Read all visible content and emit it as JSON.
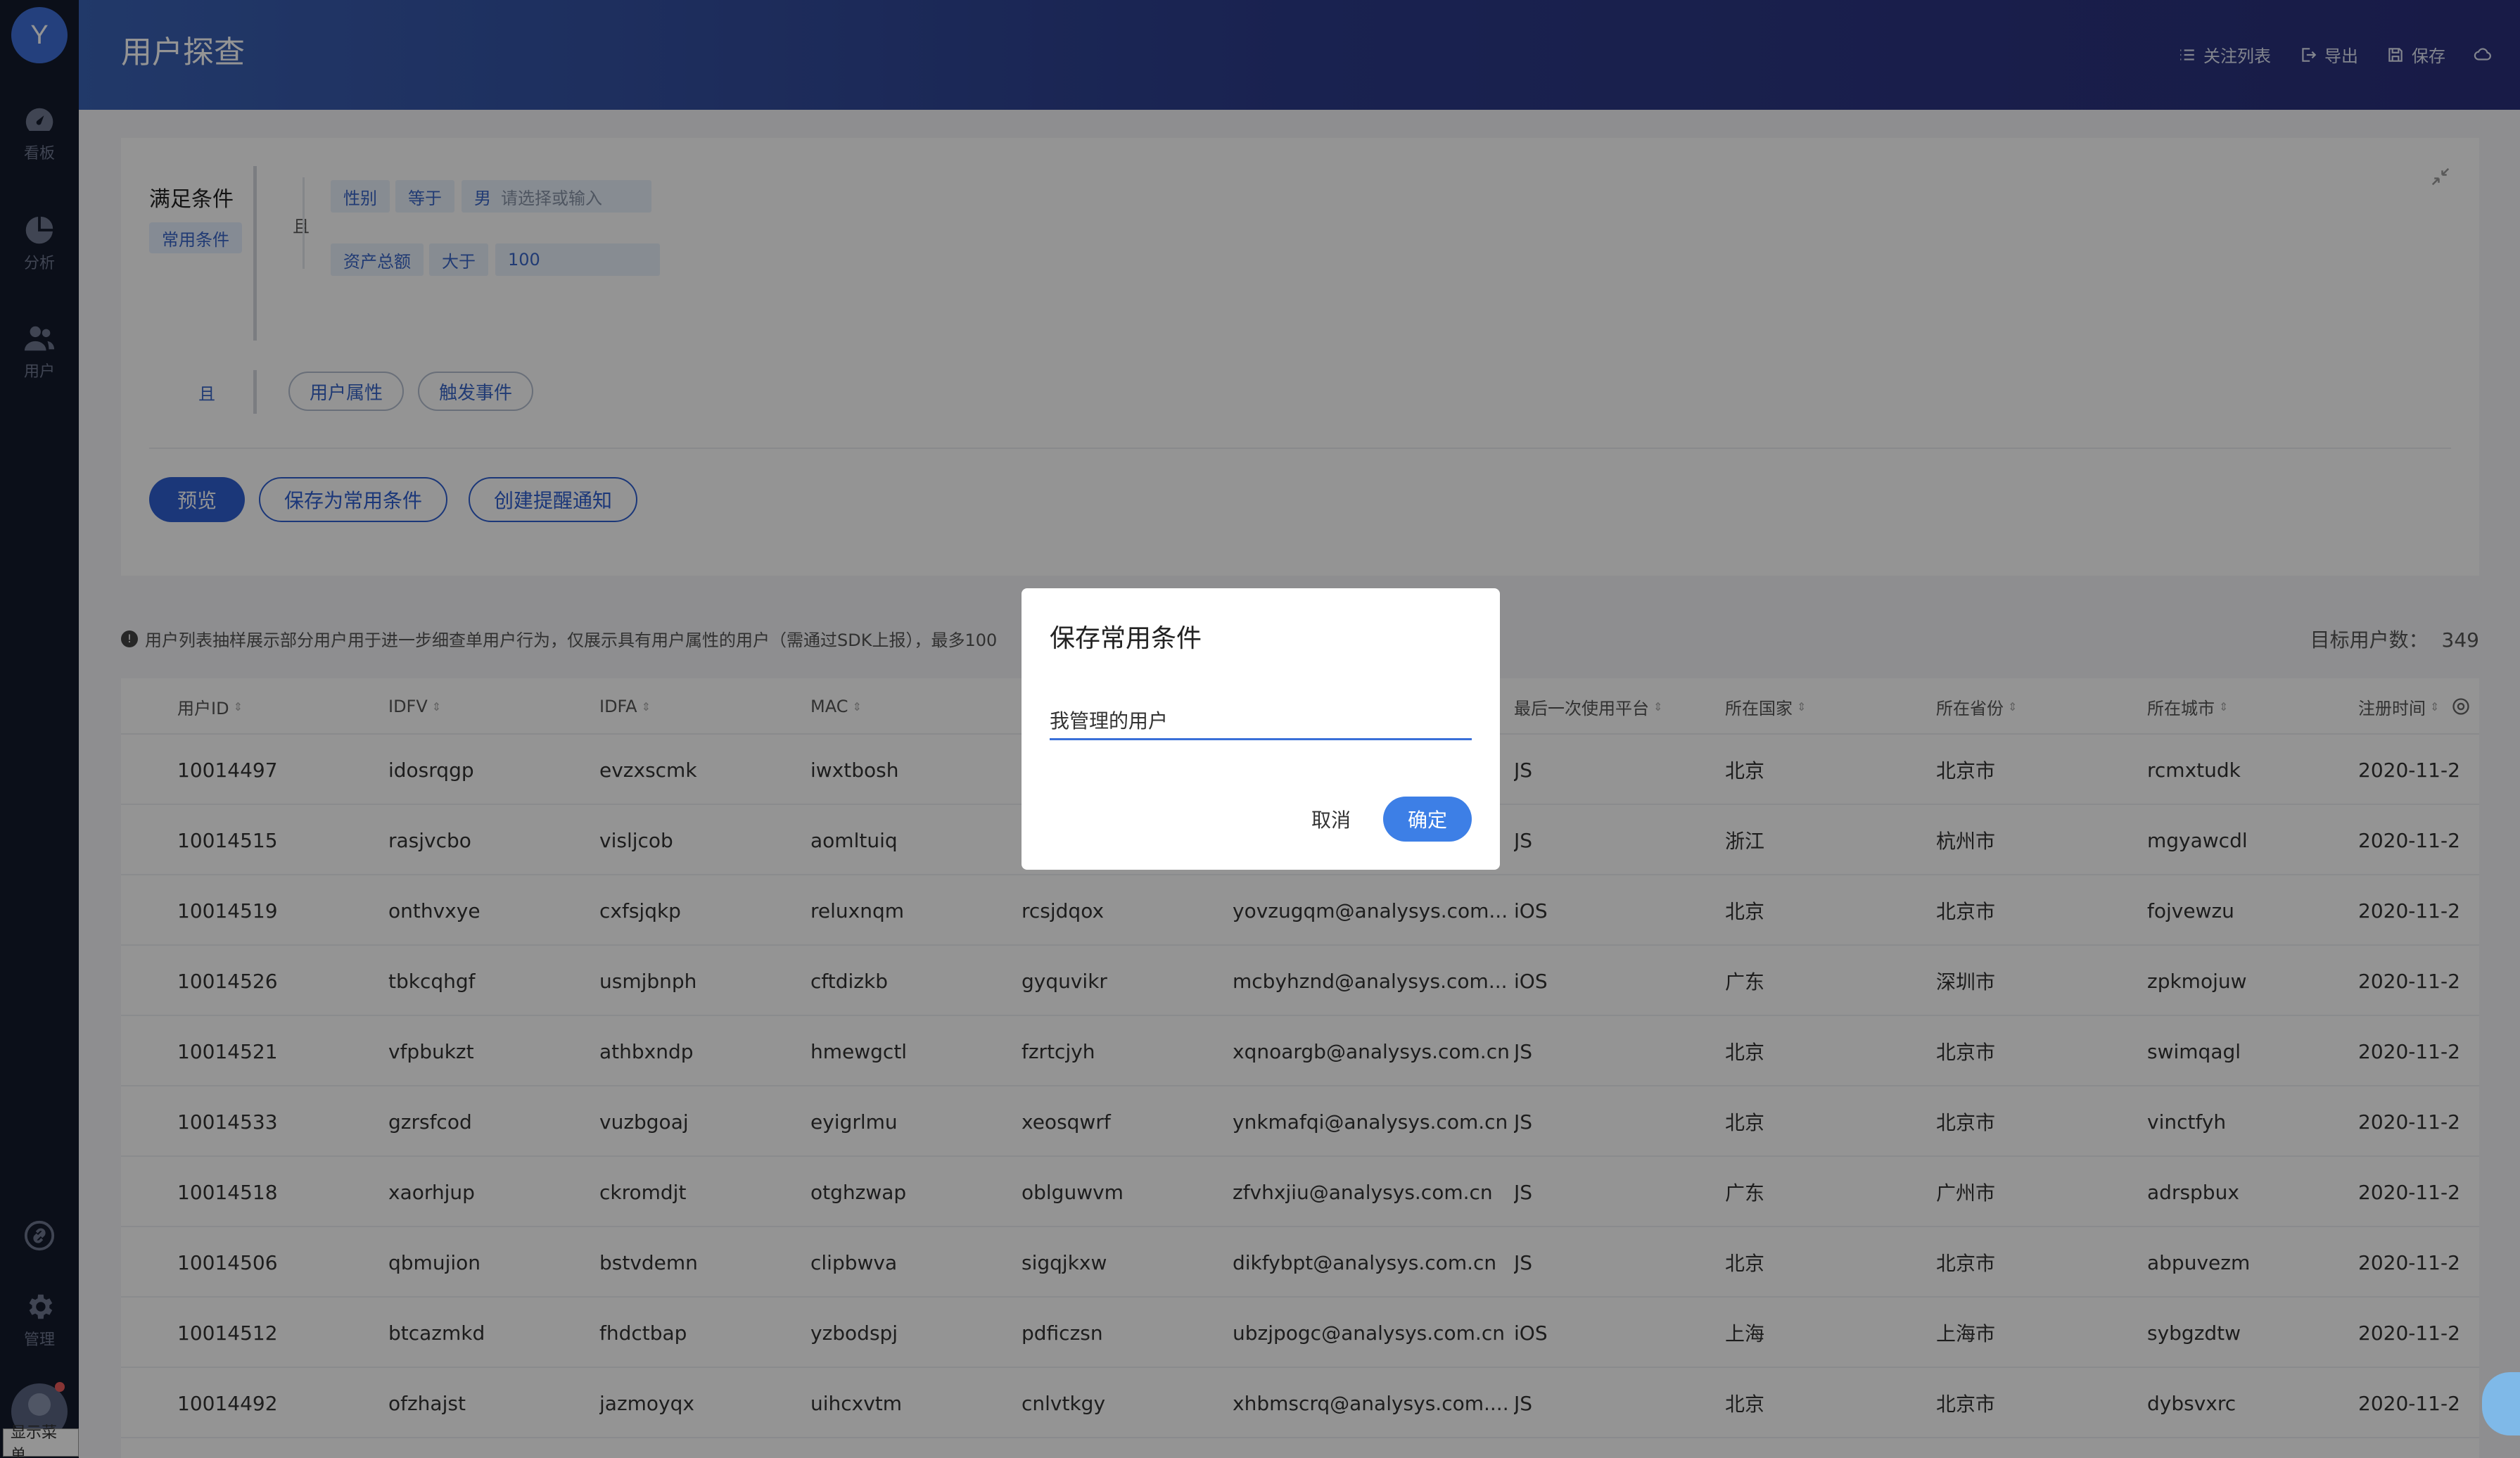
{
  "sidebar": {
    "logo": "Y",
    "items": [
      {
        "label": "看板",
        "icon": "dashboard-icon"
      },
      {
        "label": "分析",
        "icon": "pie-chart-icon"
      },
      {
        "label": "用户",
        "icon": "users-icon"
      }
    ],
    "bottom": [
      {
        "label": "",
        "icon": "link-icon"
      },
      {
        "label": "管理",
        "icon": "gear-icon"
      }
    ],
    "tooltip": "显示菜单"
  },
  "header": {
    "title": "用户探查",
    "actions": [
      {
        "label": "关注列表",
        "icon": "list-icon"
      },
      {
        "label": "导出",
        "icon": "export-icon"
      },
      {
        "label": "保存",
        "icon": "save-icon"
      },
      {
        "label": "",
        "icon": "cloud-icon"
      }
    ]
  },
  "conditions": {
    "title": "满足条件",
    "common_tag": "常用条件",
    "and": "且",
    "rows": [
      {
        "field": "性别",
        "op": "等于",
        "value": "男",
        "placeholder": "请选择或输入"
      },
      {
        "field": "资产总额",
        "op": "大于",
        "value": "100"
      }
    ],
    "outer_and": "且",
    "add_buttons": [
      "用户属性",
      "触发事件"
    ],
    "actions": {
      "preview": "预览",
      "save_common": "保存为常用条件",
      "create_alert": "创建提醒通知"
    }
  },
  "info": {
    "text": "用户列表抽样展示部分用户用于进一步细查单用户行为，仅展示具有用户属性的用户（需通过SDK上报），最多100",
    "target_label": "目标用户数：",
    "target_value": "349"
  },
  "table": {
    "columns": [
      "用户ID",
      "IDFV",
      "IDFA",
      "MAC",
      "",
      "",
      "最后一次使用平台",
      "所在国家",
      "所在省份",
      "所在城市",
      "注册时间"
    ],
    "rows": [
      [
        "10014497",
        "idosrqgp",
        "evzxscmk",
        "iwxtbosh",
        "",
        "",
        "JS",
        "北京",
        "北京市",
        "rcmxtudk",
        "2020-11-2"
      ],
      [
        "10014515",
        "rasjvcbo",
        "visljcob",
        "aomltuiq",
        "",
        "",
        "JS",
        "浙江",
        "杭州市",
        "mgyawcdl",
        "2020-11-2"
      ],
      [
        "10014519",
        "onthvxye",
        "cxfsjqkp",
        "reluxnqm",
        "rcsjdqox",
        "yovzugqm@analysys.com...",
        "iOS",
        "北京",
        "北京市",
        "fojvewzu",
        "2020-11-2"
      ],
      [
        "10014526",
        "tbkcqhgf",
        "usmjbnph",
        "cftdizkb",
        "gyquvikr",
        "mcbyhznd@analysys.com...",
        "iOS",
        "广东",
        "深圳市",
        "zpkmojuw",
        "2020-11-2"
      ],
      [
        "10014521",
        "vfpbukzt",
        "athbxndp",
        "hmewgctl",
        "fzrtcjyh",
        "xqnoargb@analysys.com.cn",
        "JS",
        "北京",
        "北京市",
        "swimqagl",
        "2020-11-2"
      ],
      [
        "10014533",
        "gzrsfcod",
        "vuzbgoaj",
        "eyigrlmu",
        "xeosqwrf",
        "ynkmafqi@analysys.com.cn",
        "JS",
        "北京",
        "北京市",
        "vinctfyh",
        "2020-11-2"
      ],
      [
        "10014518",
        "xaorhjup",
        "ckromdjt",
        "otghzwap",
        "oblguwvm",
        "zfvhxjiu@analysys.com.cn",
        "JS",
        "广东",
        "广州市",
        "adrspbux",
        "2020-11-2"
      ],
      [
        "10014506",
        "qbmujion",
        "bstvdemn",
        "clipbwva",
        "sigqjkxw",
        "dikfybpt@analysys.com.cn",
        "JS",
        "北京",
        "北京市",
        "abpuvezm",
        "2020-11-2"
      ],
      [
        "10014512",
        "btcazmkd",
        "fhdctbap",
        "yzbodspj",
        "pdficzsn",
        "ubzjpogc@analysys.com.cn",
        "iOS",
        "上海",
        "上海市",
        "sybgzdtw",
        "2020-11-2"
      ],
      [
        "10014492",
        "ofzhajst",
        "jazmoyqx",
        "uihcxvtm",
        "cnlvtkgy",
        "xhbmscrq@analysys.com....",
        "JS",
        "北京",
        "北京市",
        "dybsvxrc",
        "2020-11-2"
      ]
    ]
  },
  "modal": {
    "title": "保存常用条件",
    "input_value": "我管理的用户",
    "cancel": "取消",
    "confirm": "确定"
  }
}
